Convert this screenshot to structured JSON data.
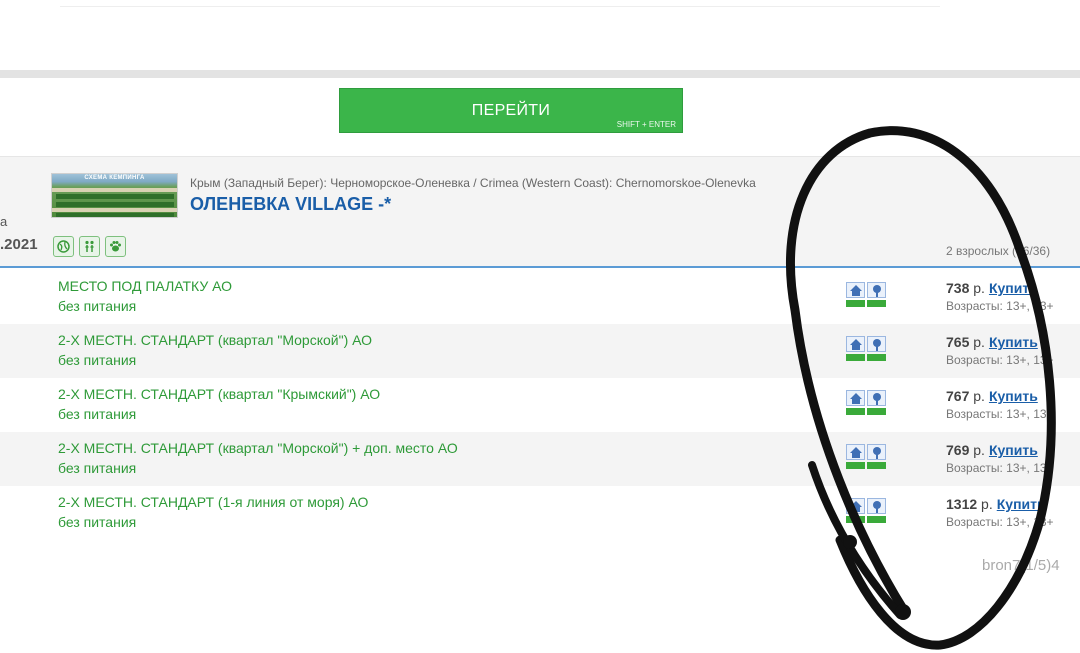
{
  "go_button": {
    "label": "ПЕРЕЙТИ",
    "shortcut": "SHIFT + ENTER"
  },
  "left_partial": {
    "a": "а",
    "date": ".2021"
  },
  "hotel": {
    "thumb_caption": "СХЕМА КЕМПИНГА",
    "location": "Крым (Западный Берег): Черноморское-Оленевка / Crimea (Western Coast): Chernomorskoe-Olenevka",
    "name": "ОЛЕНЕВКА VILLAGE -*",
    "occupancy": "2 взрослых (36/36)",
    "feature_icons": [
      "globe-icon",
      "people-icon",
      "paw-icon"
    ]
  },
  "rooms": [
    {
      "name": "МЕСТО ПОД ПАЛАТКУ АО",
      "meal": "без питания",
      "price": "738",
      "currency": "р.",
      "buy": "Купить",
      "ages": "Возрасты: 13+, 13+"
    },
    {
      "name": "2-Х МЕСТН. СТАНДАРТ (квартал \"Морской\") АО",
      "meal": "без питания",
      "price": "765",
      "currency": "р.",
      "buy": "Купить",
      "ages": "Возрасты: 13+, 13+"
    },
    {
      "name": "2-Х МЕСТН. СТАНДАРТ (квартал \"Крымский\") АО",
      "meal": "без питания",
      "price": "767",
      "currency": "р.",
      "buy": "Купить",
      "ages": "Возрасты: 13+, 13+"
    },
    {
      "name": "2-Х МЕСТН. СТАНДАРТ (квартал \"Морской\") + доп. место АО",
      "meal": "без питания",
      "price": "769",
      "currency": "р.",
      "buy": "Купить",
      "ages": "Возрасты: 13+, 13+"
    },
    {
      "name": "2-Х МЕСТН. СТАНДАРТ (1-я линия от моря) АО",
      "meal": "без питания",
      "price": "1312",
      "currency": "р.",
      "buy": "Купить",
      "ages": "Возрасты: 13+, 13+"
    }
  ],
  "footer_code": "bron7(1/5)4",
  "colors": {
    "button_green": "#3bb54a",
    "room_text_green": "#2e9a38",
    "link_blue": "#1a5ea8",
    "header_line_blue": "#5b9bd5",
    "scribble": "#111111"
  }
}
